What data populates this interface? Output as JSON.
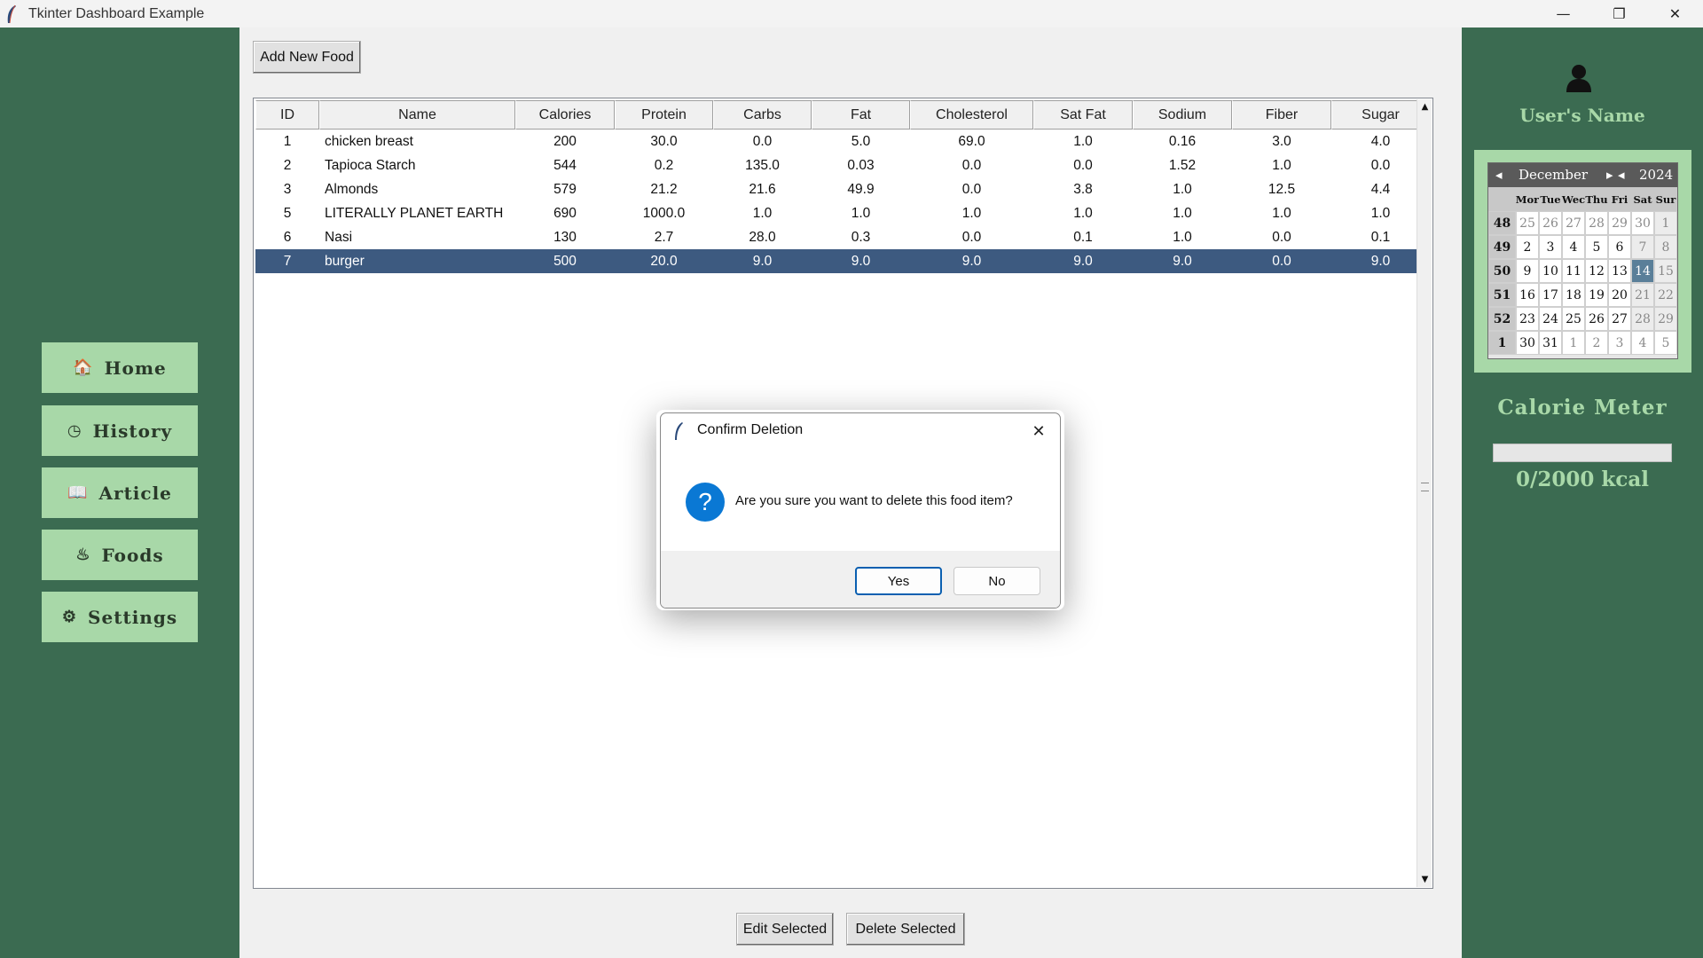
{
  "window": {
    "title": "Tkinter Dashboard Example",
    "controls": {
      "minimize": "—",
      "maximize": "❐",
      "close": "✕"
    }
  },
  "sidebar": {
    "items": [
      {
        "label": "Home",
        "icon": "home-icon",
        "glyph": "🏠"
      },
      {
        "label": "History",
        "icon": "clock-icon",
        "glyph": "◷"
      },
      {
        "label": "Article",
        "icon": "book-icon",
        "glyph": "📖"
      },
      {
        "label": "Foods",
        "icon": "food-icon",
        "glyph": "♨"
      },
      {
        "label": "Settings",
        "icon": "gear-icon",
        "glyph": "⚙"
      }
    ]
  },
  "toolbar": {
    "add_label": "Add New Food"
  },
  "table": {
    "columns": [
      "ID",
      "Name",
      "Calories",
      "Protein",
      "Carbs",
      "Fat",
      "Cholesterol",
      "Sat Fat",
      "Sodium",
      "Fiber",
      "Sugar"
    ],
    "rows": [
      [
        "1",
        "chicken breast",
        "200",
        "30.0",
        "0.0",
        "5.0",
        "69.0",
        "1.0",
        "0.16",
        "3.0",
        "4.0"
      ],
      [
        "2",
        "Tapioca Starch",
        "544",
        "0.2",
        "135.0",
        "0.03",
        "0.0",
        "0.0",
        "1.52",
        "1.0",
        "0.0"
      ],
      [
        "3",
        "Almonds",
        "579",
        "21.2",
        "21.6",
        "49.9",
        "0.0",
        "3.8",
        "1.0",
        "12.5",
        "4.4"
      ],
      [
        "5",
        "LITERALLY PLANET EARTH",
        "690",
        "1000.0",
        "1.0",
        "1.0",
        "1.0",
        "1.0",
        "1.0",
        "1.0",
        "1.0"
      ],
      [
        "6",
        "Nasi",
        "130",
        "2.7",
        "28.0",
        "0.3",
        "0.0",
        "0.1",
        "1.0",
        "0.0",
        "0.1"
      ],
      [
        "7",
        "burger",
        "500",
        "20.0",
        "9.0",
        "9.0",
        "9.0",
        "9.0",
        "9.0",
        "0.0",
        "9.0"
      ]
    ],
    "selected_row": 5
  },
  "actions": {
    "edit_label": "Edit Selected",
    "delete_label": "Delete Selected"
  },
  "user": {
    "name": "User's Name"
  },
  "calendar": {
    "month": "December",
    "year": "2024",
    "prev_month": "◂",
    "next_month": "▸",
    "prev_year": "◂",
    "next_year": "▸",
    "weekdays": [
      "Mor",
      "Tue",
      "Wec",
      "Thu",
      "Fri",
      "Sat",
      "Sur"
    ],
    "weeks": [
      {
        "num": "48",
        "days": [
          "25",
          "26",
          "27",
          "28",
          "29",
          "30",
          "1"
        ],
        "other": [
          true,
          true,
          true,
          true,
          true,
          true,
          false
        ]
      },
      {
        "num": "49",
        "days": [
          "2",
          "3",
          "4",
          "5",
          "6",
          "7",
          "8"
        ],
        "other": [
          false,
          false,
          false,
          false,
          false,
          false,
          false
        ]
      },
      {
        "num": "50",
        "days": [
          "9",
          "10",
          "11",
          "12",
          "13",
          "14",
          "15"
        ],
        "other": [
          false,
          false,
          false,
          false,
          false,
          false,
          false
        ]
      },
      {
        "num": "51",
        "days": [
          "16",
          "17",
          "18",
          "19",
          "20",
          "21",
          "22"
        ],
        "other": [
          false,
          false,
          false,
          false,
          false,
          false,
          false
        ]
      },
      {
        "num": "52",
        "days": [
          "23",
          "24",
          "25",
          "26",
          "27",
          "28",
          "29"
        ],
        "other": [
          false,
          false,
          false,
          false,
          false,
          false,
          false
        ]
      },
      {
        "num": "1",
        "days": [
          "30",
          "31",
          "1",
          "2",
          "3",
          "4",
          "5"
        ],
        "other": [
          false,
          false,
          true,
          true,
          true,
          true,
          true
        ]
      }
    ],
    "selected_day": "14"
  },
  "calorie_meter": {
    "title": "Calorie Meter",
    "consumed": 0,
    "goal": 2000,
    "text": "0/2000 kcal",
    "fill_fraction": 0.0,
    "fill_color": "#06b025"
  },
  "dialog": {
    "title": "Confirm Deletion",
    "message": "Are you sure you want to delete this food item?",
    "icon": "question-icon",
    "icon_glyph": "?",
    "yes_label": "Yes",
    "no_label": "No",
    "close_glyph": "✕"
  },
  "colors": {
    "sidebar_bg": "#3b6b51",
    "nav_button": "#a8d8a8",
    "selected_row": "#3d5a80",
    "dialog_accent": "#0a78d4"
  }
}
